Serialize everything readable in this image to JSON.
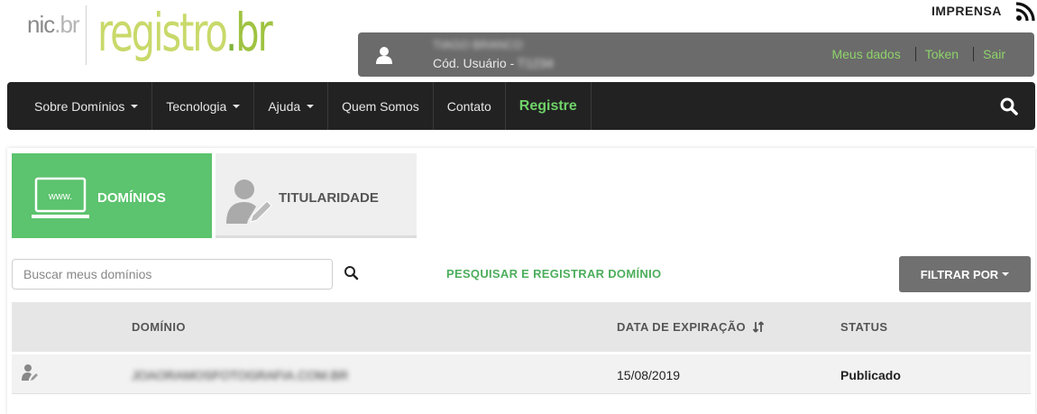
{
  "header": {
    "logo_nic": "nic",
    "logo_nic_tld": ".br",
    "logo_main": "registro",
    "logo_tld": "br",
    "press_link": "IMPRENSA",
    "rss_icon": "rss-icon"
  },
  "userbar": {
    "user_name": "TIAGO BRANCO",
    "code_label": "Cód. Usuário - ",
    "code_value": "T1234",
    "links": [
      "Meus dados",
      "Token",
      "Sair"
    ]
  },
  "nav": {
    "items": [
      {
        "label": "Sobre Domínios",
        "dropdown": true
      },
      {
        "label": "Tecnologia",
        "dropdown": true
      },
      {
        "label": "Ajuda",
        "dropdown": true
      },
      {
        "label": "Quem Somos",
        "dropdown": false
      },
      {
        "label": "Contato",
        "dropdown": false
      },
      {
        "label": "Registre",
        "dropdown": false
      }
    ],
    "search_icon": "search-icon"
  },
  "tabs": {
    "domains_label": "DOMÍNIOS",
    "domains_icon_text": "www.",
    "ownership_label": "TITULARIDADE"
  },
  "toolbar": {
    "search_placeholder": "Buscar meus domínios",
    "search_value": "",
    "register_link": "PESQUISAR E REGISTRAR DOMÍNIO",
    "filter_label": "FILTRAR POR"
  },
  "table": {
    "columns": [
      "DOMÍNIO",
      "DATA DE EXPIRAÇÃO",
      "STATUS"
    ],
    "rows": [
      {
        "domain": "JOAORAMOSFOTOGRAFIA.COM.BR",
        "expiration": "15/08/2019",
        "status": "Publicado"
      }
    ]
  },
  "colors": {
    "accent_green": "#5cc36e",
    "link_green": "#4cae5c",
    "navbar_bg": "#222222",
    "userbar_bg": "#6b6b6b"
  }
}
